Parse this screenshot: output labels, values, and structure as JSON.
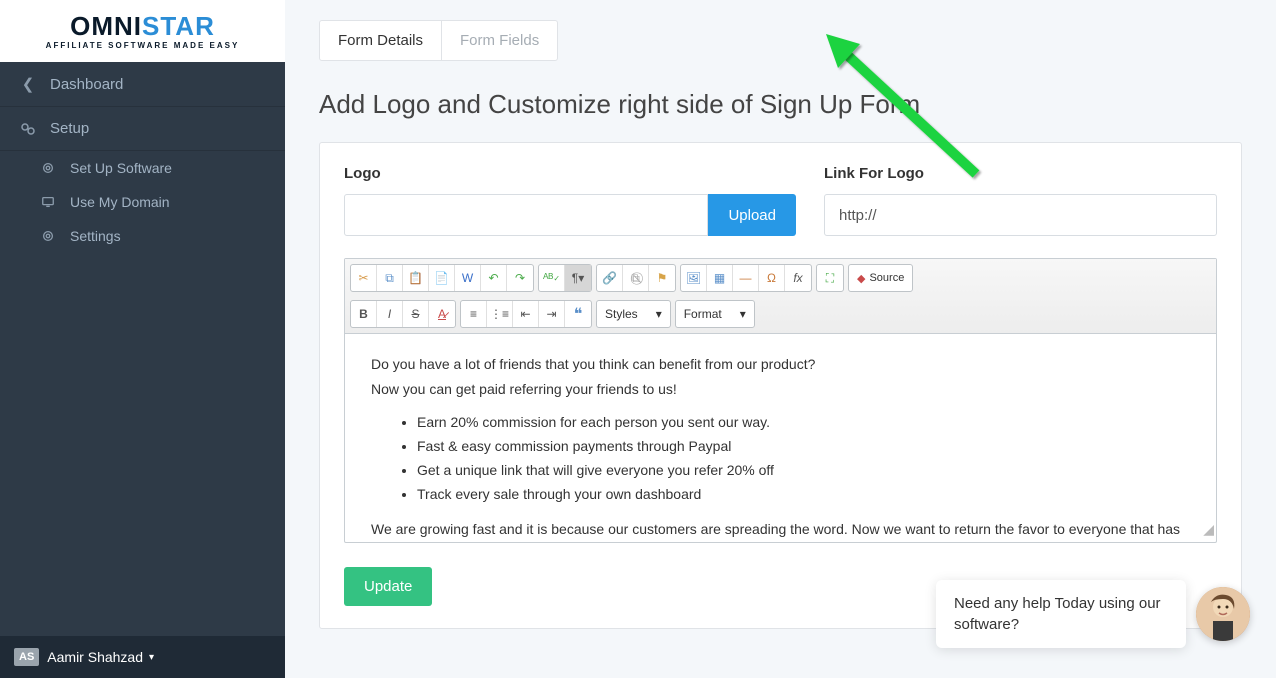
{
  "logo": {
    "brand_a": "OMNI",
    "brand_b": "STAR",
    "tagline": "AFFILIATE SOFTWARE MADE EASY"
  },
  "sidebar": {
    "dashboard": "Dashboard",
    "setup": "Setup",
    "items": {
      "set_up_software": "Set Up Software",
      "use_my_domain": "Use My Domain",
      "settings": "Settings"
    }
  },
  "user": {
    "initials": "AS",
    "name": "Aamir Shahzad"
  },
  "tabs": {
    "form_details": "Form Details",
    "form_fields": "Form Fields"
  },
  "page_title": "Add Logo and Customize right side of Sign Up Form",
  "form": {
    "logo_label": "Logo",
    "upload_btn": "Upload",
    "link_label": "Link For Logo",
    "link_value": "http://"
  },
  "toolbar": {
    "styles": "Styles",
    "format": "Format",
    "source": "Source"
  },
  "editor": {
    "p1": "Do you have a lot of friends that you think can benefit from our product?",
    "p2": "Now you can get paid referring your friends to us!",
    "li1": "Earn 20% commission for each person you sent our way.",
    "li2": "Fast & easy commission payments through Paypal",
    "li3": "Get a unique link that will give everyone you refer 20% off",
    "li4": "Track every sale through your own dashboard",
    "p3": "We are growing fast and it is because our customers are spreading the word. Now we want to return the favor to everyone that has helped us. Start getting paid today!"
  },
  "buttons": {
    "update": "Update"
  },
  "chat": {
    "message": "Need any help Today using our software?"
  }
}
